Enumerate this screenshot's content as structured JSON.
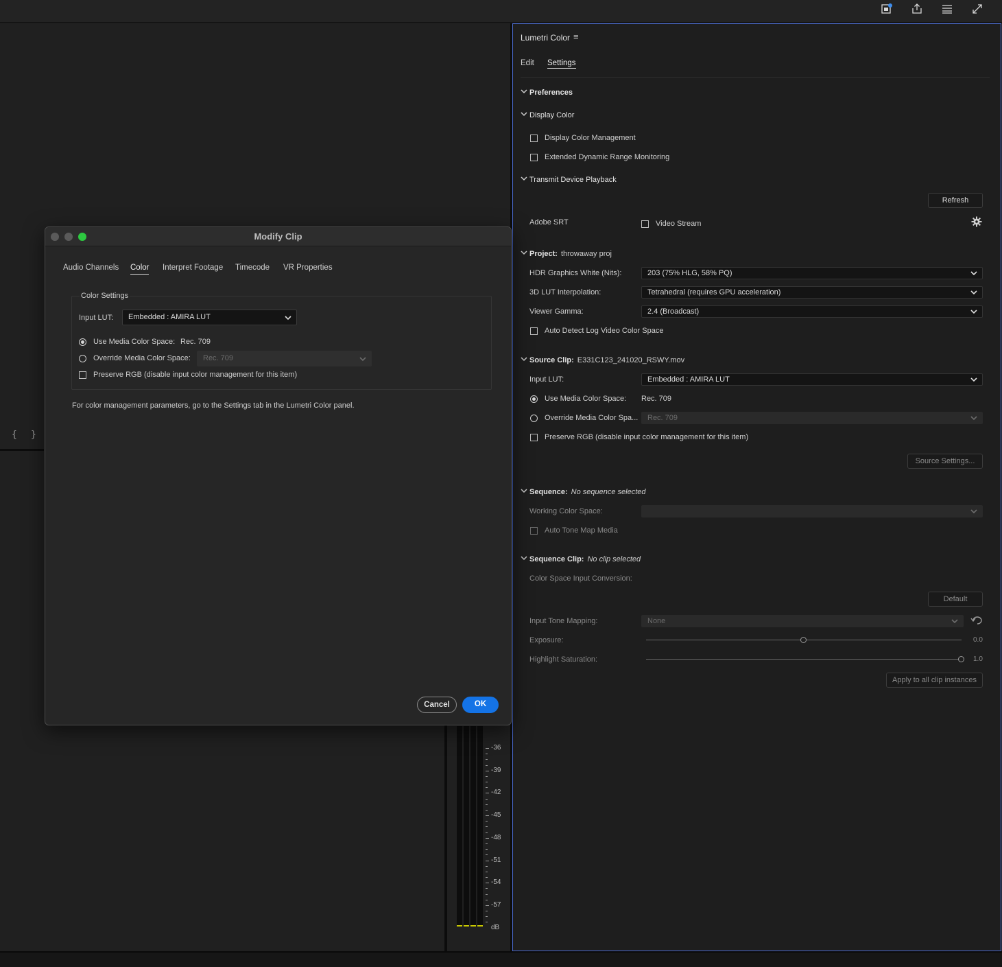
{
  "topbar": {
    "icons": [
      "quick-export-icon",
      "share-icon",
      "workspaces-icon",
      "fullscreen-icon"
    ]
  },
  "monitor": {
    "brackets": [
      "{",
      "}"
    ],
    "meter_labels": [
      "-36",
      "-39",
      "-42",
      "-45",
      "-48",
      "-51",
      "-54",
      "-57",
      "dB"
    ]
  },
  "lumetri": {
    "title": "Lumetri Color",
    "menu_icon": "≡",
    "tabs": [
      {
        "label": "Edit",
        "active": false
      },
      {
        "label": "Settings",
        "active": true
      }
    ],
    "preferences": "Preferences",
    "display_color": {
      "heading": "Display Color",
      "display_color_management": "Display Color Management",
      "extended_dynamic_range": "Extended Dynamic Range Monitoring"
    },
    "transmit": {
      "heading": "Transmit Device Playback",
      "refresh": "Refresh",
      "adobe_srt": "Adobe SRT",
      "video_stream": "Video Stream"
    },
    "project": {
      "heading": "Project:",
      "name": "throwaway proj",
      "hdr_label": "HDR Graphics White (Nits):",
      "hdr_value": "203 (75% HLG, 58% PQ)",
      "lut_interp_label": "3D LUT Interpolation:",
      "lut_interp_value": "Tetrahedral (requires GPU acceleration)",
      "gamma_label": "Viewer Gamma:",
      "gamma_value": "2.4 (Broadcast)",
      "auto_detect": "Auto Detect Log Video Color Space"
    },
    "source_clip": {
      "heading": "Source Clip:",
      "name": "E331C123_241020_RSWY.mov",
      "input_lut_label": "Input LUT:",
      "input_lut_value": "Embedded : AMIRA LUT",
      "use_media": "Use Media Color Space:",
      "use_media_value": "Rec. 709",
      "override": "Override Media Color Spa...",
      "override_value": "Rec. 709",
      "preserve_rgb": "Preserve RGB (disable input color management for this item)",
      "source_settings": "Source Settings..."
    },
    "sequence": {
      "heading": "Sequence:",
      "status": "No sequence selected",
      "working_cs": "Working Color Space:",
      "auto_tone_map": "Auto Tone Map Media"
    },
    "sequence_clip": {
      "heading": "Sequence Clip:",
      "status": "No clip selected",
      "cs_input_conv": "Color Space Input Conversion:",
      "default": "Default",
      "tone_mapping_label": "Input Tone Mapping:",
      "tone_mapping_value": "None",
      "exposure_label": "Exposure:",
      "exposure_value": "0.0",
      "exposure_level": 0.5,
      "highlight_label": "Highlight Saturation:",
      "highlight_value": "1.0",
      "highlight_level": 1.0,
      "apply_all": "Apply to all clip instances"
    }
  },
  "modal": {
    "title": "Modify Clip",
    "traffic_colors": [
      "#5a5a5a",
      "#5a5a5a",
      "#2dc840"
    ],
    "tabs": [
      {
        "label": "Audio Channels",
        "active": false
      },
      {
        "label": "Color",
        "active": true
      },
      {
        "label": "Interpret Footage",
        "active": false
      },
      {
        "label": "Timecode",
        "active": false
      },
      {
        "label": "VR Properties",
        "active": false
      }
    ],
    "group_title": "Color Settings",
    "input_lut_label": "Input LUT:",
    "input_lut_value": "Embedded : AMIRA LUT",
    "use_media": "Use Media Color Space:",
    "use_media_value": "Rec. 709",
    "override": "Override Media Color Space:",
    "override_value": "Rec. 709",
    "preserve_rgb": "Preserve RGB (disable input color management for this item)",
    "note": "For color management parameters, go to the Settings tab in the Lumetri Color panel.",
    "cancel": "Cancel",
    "ok": "OK",
    "ok_color": "#1473e6"
  }
}
